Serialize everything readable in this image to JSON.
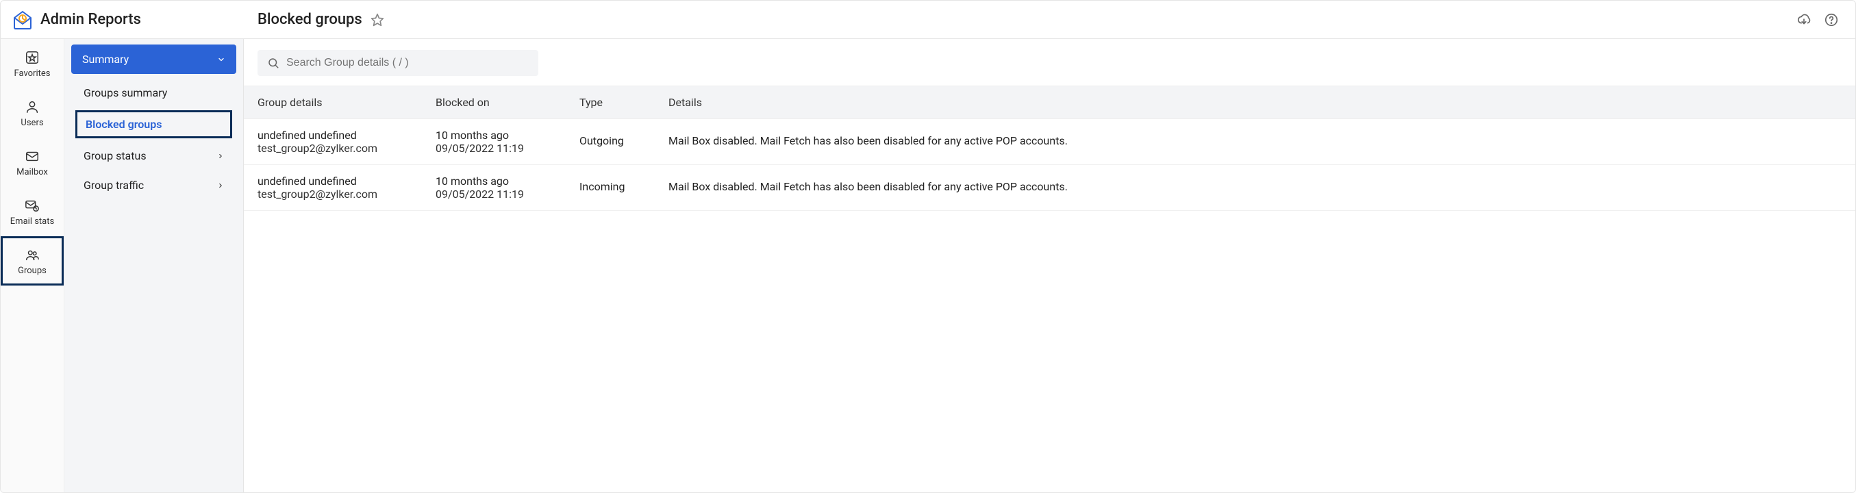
{
  "app": {
    "title": "Admin Reports"
  },
  "page": {
    "title": "Blocked groups"
  },
  "rail": {
    "items": [
      {
        "label": "Favorites"
      },
      {
        "label": "Users"
      },
      {
        "label": "Mailbox"
      },
      {
        "label": "Email stats"
      },
      {
        "label": "Groups"
      }
    ]
  },
  "sidebar": {
    "section": "Summary",
    "items": [
      {
        "label": "Groups summary"
      },
      {
        "label": "Blocked groups"
      },
      {
        "label": "Group status"
      },
      {
        "label": "Group traffic"
      }
    ]
  },
  "search": {
    "placeholder": "Search Group details ( / )"
  },
  "table": {
    "columns": [
      "Group details",
      "Blocked on",
      "Type",
      "Details"
    ],
    "rows": [
      {
        "group_name": "undefined undefined",
        "group_email": "test_group2@zylker.com",
        "blocked_rel": "10 months ago",
        "blocked_ts": "09/05/2022 11:19",
        "type": "Outgoing",
        "details": "Mail Box disabled. Mail Fetch has also been disabled for any active POP accounts."
      },
      {
        "group_name": "undefined undefined",
        "group_email": "test_group2@zylker.com",
        "blocked_rel": "10 months ago",
        "blocked_ts": "09/05/2022 11:19",
        "type": "Incoming",
        "details": "Mail Box disabled. Mail Fetch has also been disabled for any active POP accounts."
      }
    ]
  }
}
